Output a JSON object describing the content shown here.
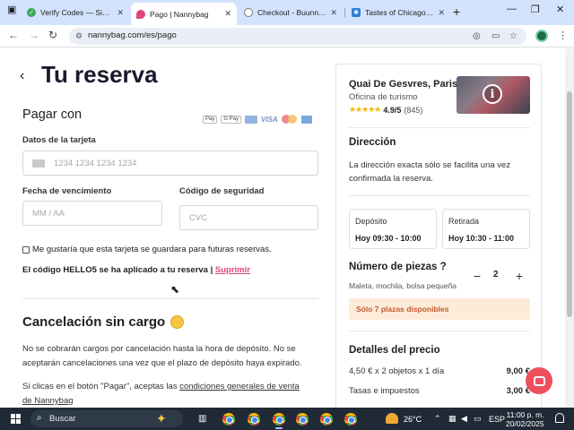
{
  "browser": {
    "tabs": [
      {
        "title": "Verify Codes — Simplyl",
        "favicon_color": "#3aa757"
      },
      {
        "title": "Pago | Nannybag",
        "favicon_color": "#e0457b"
      },
      {
        "title": "Checkout - Buunni Co",
        "favicon_color": "#777777"
      },
      {
        "title": "Tastes of Chicago - Sh",
        "favicon_color": "#2f7fd8"
      }
    ],
    "url": "nannybag.com/es/pago"
  },
  "page": {
    "title": "Tu reserva",
    "payment": {
      "heading": "Pagar con",
      "card_brands": [
        "Pay",
        "G Pay",
        "VISA"
      ],
      "card_label": "Datos de la tarjeta",
      "card_placeholder": "1234 1234 1234 1234",
      "expiry_label": "Fecha de vencimiento",
      "expiry_placeholder": "MM / AA",
      "cvc_label": "Código de seguridad",
      "cvc_placeholder": "CVC",
      "save_card_label": "Me gustaría que esta tarjeta se guardara para futuras reservas.",
      "promo_text": "El código HELLO5 se ha aplicado a tu reserva |",
      "promo_remove": "Suprimir"
    },
    "cancellation": {
      "heading": "Cancelación sin cargo",
      "text": "No se cobrarán cargos por cancelación hasta la hora de depósito. No se aceptarán cancelaciones una vez que el plazo de depósito haya expirado.",
      "terms_prefix": "Si clicas en el botón \"Pagar\", aceptas las ",
      "terms_link": "condiciones generales de venta de Nannybag"
    },
    "summary": {
      "location_name": "Quai De Gesvres, Paris",
      "location_type": "Oficina de turismo",
      "stars": "★★★★★",
      "rating": "4.9/5",
      "reviews": "(845)",
      "address_heading": "Dirección",
      "address_text": "La dirección exacta sólo se facilita una vez confirmada la reserva.",
      "deposit_label": "Depósito",
      "deposit_value": "Hoy 09:30 - 10:00",
      "pickup_label": "Retirada",
      "pickup_value": "Hoy 10:30 - 11:00",
      "pieces_heading": "Número de piezas ?",
      "pieces_sub": "Maleta, mochila, bolsa pequeña",
      "pieces_count": "2",
      "availability": "Sólo 7 plazas disponibles",
      "price_heading": "Detalles del precio",
      "price_rows": [
        {
          "label": "4,50 € x 2 objetos x 1 día",
          "amount": "9,00 €"
        },
        {
          "label": "Tasas e impuestos",
          "amount": "3,00 €"
        }
      ]
    }
  },
  "taskbar": {
    "search_placeholder": "Buscar",
    "temperature": "26°C",
    "language": "ESP",
    "time": "11:00 p. m.",
    "date": "20/02/2025"
  }
}
